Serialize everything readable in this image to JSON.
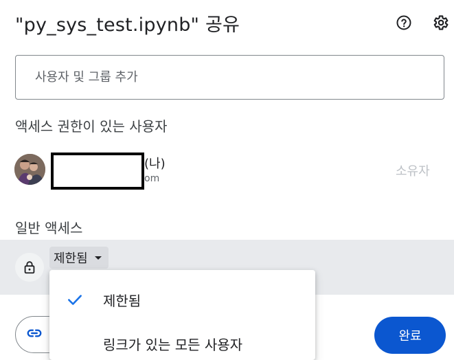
{
  "dialog": {
    "title": "\"py_sys_test.ipynb\" 공유",
    "help_icon": "help-circle-icon",
    "settings_icon": "gear-icon"
  },
  "add_people": {
    "placeholder": "사용자 및 그룹 추가"
  },
  "access_section": {
    "label": "액세스 권한이 있는 사용자",
    "users": [
      {
        "name_visible_fragment": "(나)",
        "email_visible_fragment": "om",
        "role": "소유자"
      }
    ]
  },
  "general_access": {
    "label": "일반 액세스",
    "lock_icon": "lock-icon",
    "selected": "제한됨"
  },
  "access_menu": {
    "options": [
      {
        "label": "제한됨",
        "checked": true
      },
      {
        "label": "링크가 있는 모든 사용자",
        "checked": false
      }
    ]
  },
  "footer": {
    "copy_link_icon": "link-icon",
    "done_label": "완료"
  },
  "colors": {
    "primary": "#0b57d0",
    "check": "#1a73e8",
    "selected_row_bg": "#e8eaed"
  }
}
